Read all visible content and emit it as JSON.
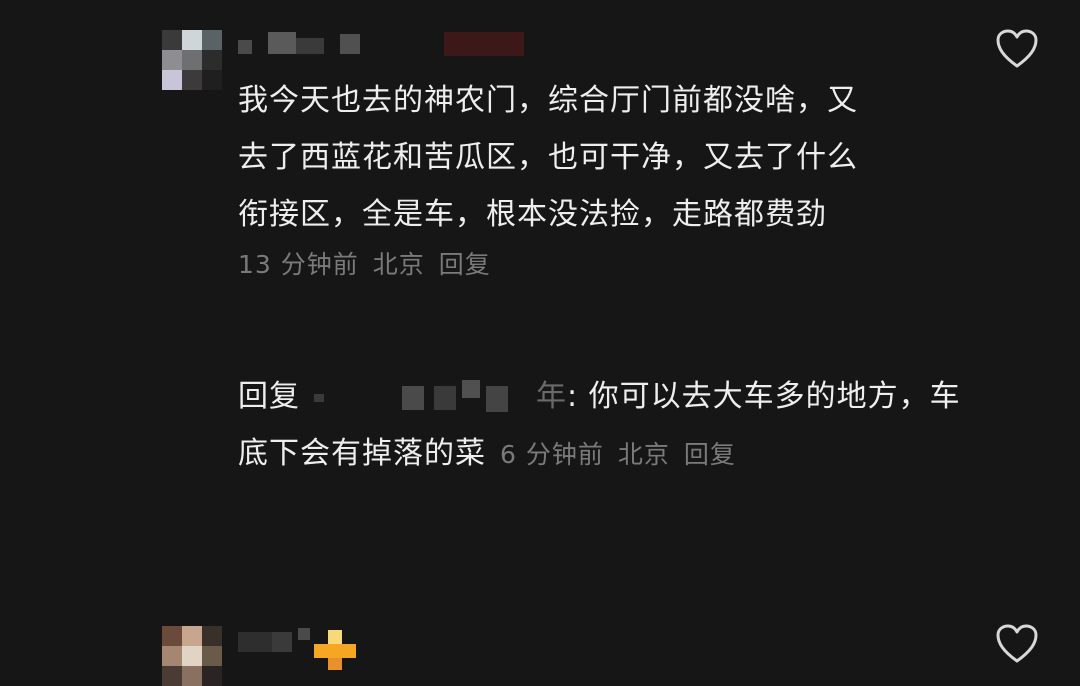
{
  "comments": [
    {
      "text_lines": [
        "我今天也去的神农门，综合厅门前都没啥，又",
        "去了西蓝花和苦瓜区，也可干净，又去了什么",
        "衔接区，全是车，根本没法捡，走路都费劲"
      ],
      "time": "13 分钟前",
      "location": "北京",
      "reply_label": "回复",
      "like_icon": "heart-outline-icon"
    },
    {
      "reply_prefix": "回复",
      "reply_name_tail": "年",
      "text_line1": ": 你可以去大车多的地方，车",
      "text_line2": "底下会有掉落的菜",
      "time": "6 分钟前",
      "location": "北京",
      "reply_label": "回复",
      "like_icon": "heart-outline-icon"
    }
  ],
  "colors": {
    "background": "#161616",
    "text": "#eeeeee",
    "meta": "#7a7a7a"
  }
}
